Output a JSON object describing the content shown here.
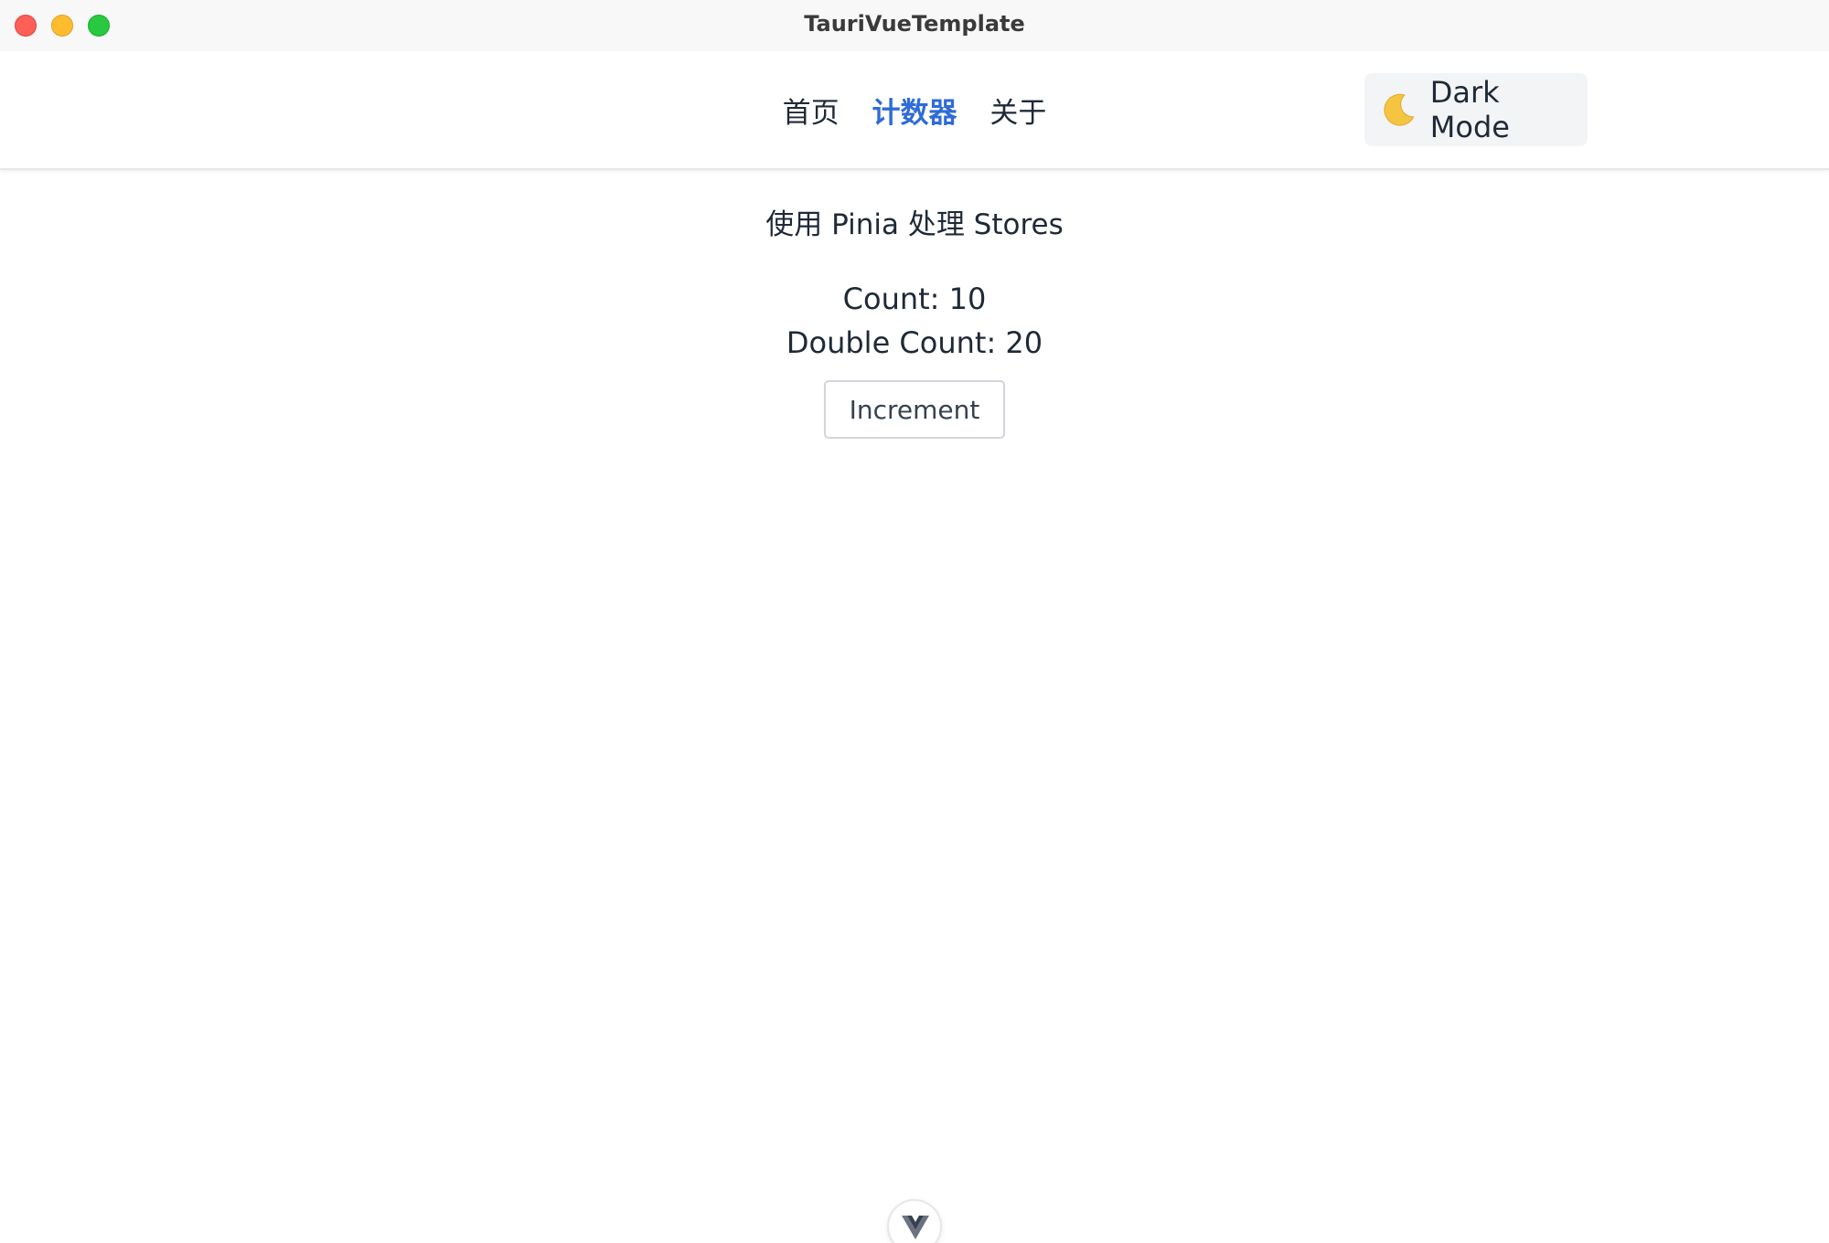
{
  "window": {
    "title": "TauriVueTemplate"
  },
  "nav": {
    "items": [
      {
        "label": "首页",
        "active": false
      },
      {
        "label": "计数器",
        "active": true
      },
      {
        "label": "关于",
        "active": false
      }
    ],
    "accent_color": "#2f6bd8"
  },
  "theme_toggle": {
    "icon": "moon-icon",
    "label": "Dark Mode"
  },
  "main": {
    "title": "使用 Pinia 处理 Stores",
    "count_text": "Count: 10",
    "double_count_text": "Double Count: 20",
    "increment_label": "Increment"
  },
  "devtools": {
    "icon": "vue-logo-icon"
  }
}
